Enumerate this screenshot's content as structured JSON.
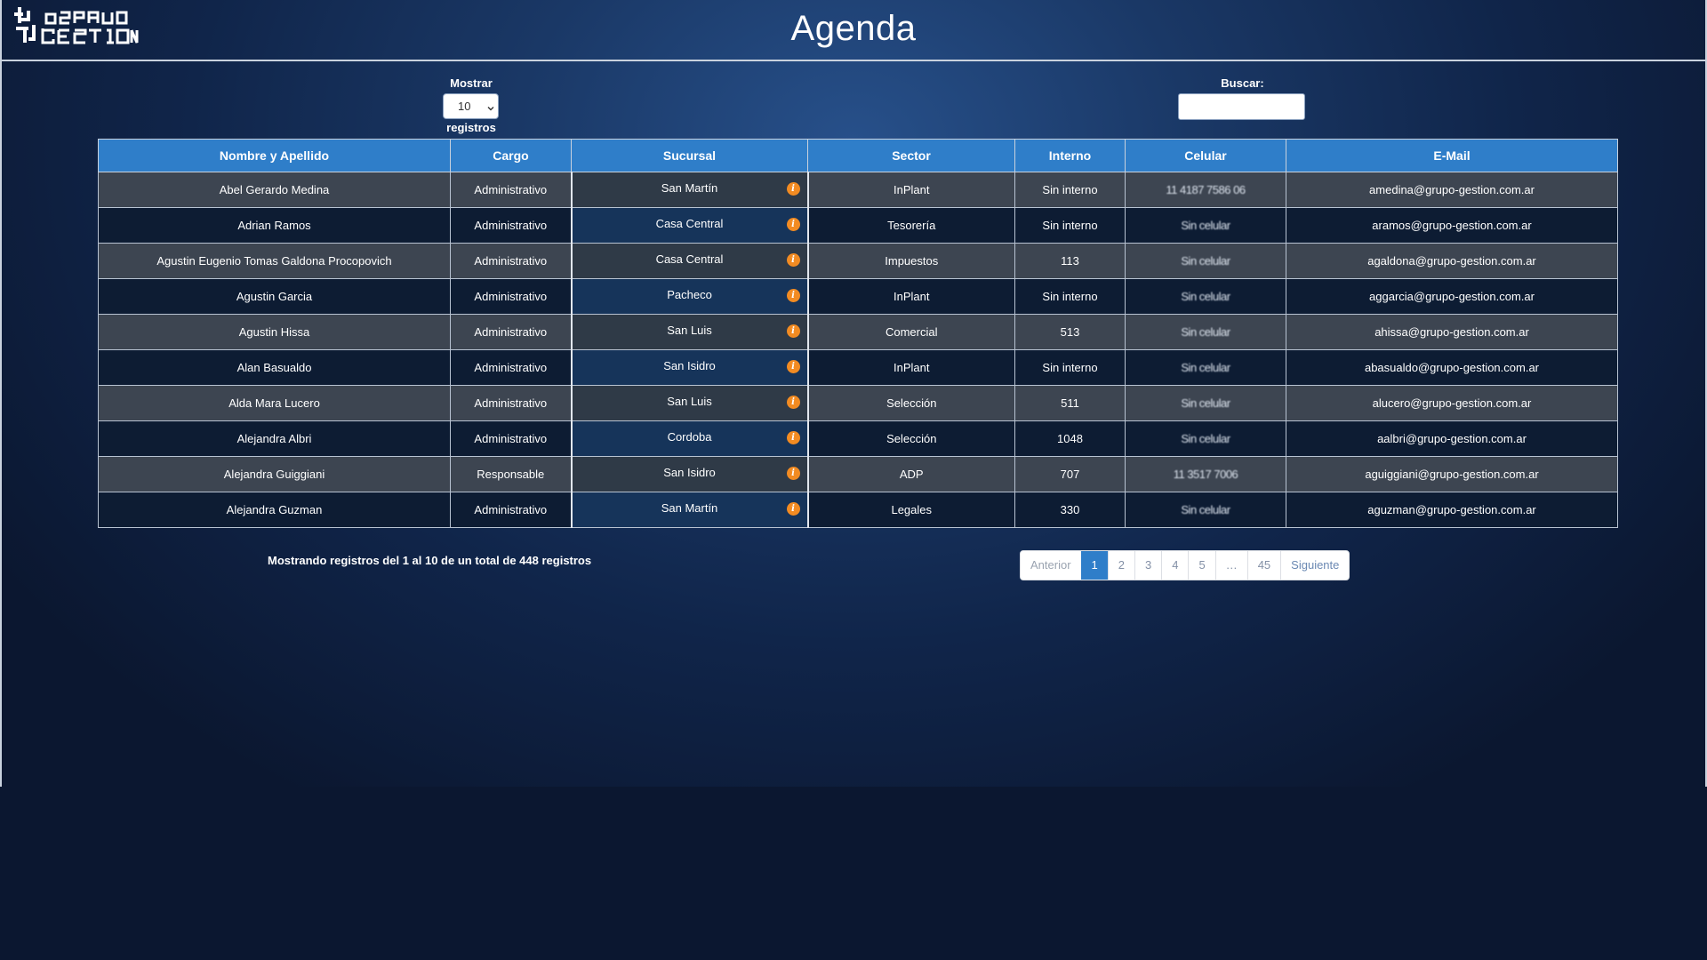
{
  "header": {
    "title": "Agenda",
    "logo_text": "GRUPO GESTION"
  },
  "controls": {
    "show_label": "Mostrar",
    "page_size": "10",
    "records_label": "registros",
    "search_label": "Buscar:",
    "search_value": ""
  },
  "table": {
    "columns": [
      "Nombre y Apellido",
      "Cargo",
      "Sucursal",
      "Sector",
      "Interno",
      "Celular",
      "E-Mail"
    ],
    "rows": [
      {
        "name": "Abel Gerardo Medina",
        "role": "Administrativo",
        "branch": "San Martín",
        "sector": "InPlant",
        "ext": "Sin interno",
        "cell": "11 4187 7586 06",
        "email": "amedina@grupo-gestion.com.ar"
      },
      {
        "name": "Adrian Ramos",
        "role": "Administrativo",
        "branch": "Casa Central",
        "sector": "Tesorería",
        "ext": "Sin interno",
        "cell": "Sin celular",
        "email": "aramos@grupo-gestion.com.ar"
      },
      {
        "name": "Agustin Eugenio Tomas Galdona Procopovich",
        "role": "Administrativo",
        "branch": "Casa Central",
        "sector": "Impuestos",
        "ext": "113",
        "cell": "Sin celular",
        "email": "agaldona@grupo-gestion.com.ar"
      },
      {
        "name": "Agustin Garcia",
        "role": "Administrativo",
        "branch": "Pacheco",
        "sector": "InPlant",
        "ext": "Sin interno",
        "cell": "Sin celular",
        "email": "aggarcia@grupo-gestion.com.ar"
      },
      {
        "name": "Agustin Hissa",
        "role": "Administrativo",
        "branch": "San Luis",
        "sector": "Comercial",
        "ext": "513",
        "cell": "Sin celular",
        "email": "ahissa@grupo-gestion.com.ar"
      },
      {
        "name": "Alan Basualdo",
        "role": "Administrativo",
        "branch": "San Isidro",
        "sector": "InPlant",
        "ext": "Sin interno",
        "cell": "Sin celular",
        "email": "abasualdo@grupo-gestion.com.ar"
      },
      {
        "name": "Alda Mara Lucero",
        "role": "Administrativo",
        "branch": "San Luis",
        "sector": "Selección",
        "ext": "511",
        "cell": "Sin celular",
        "email": "alucero@grupo-gestion.com.ar"
      },
      {
        "name": "Alejandra Albri",
        "role": "Administrativo",
        "branch": "Cordoba",
        "sector": "Selección",
        "ext": "1048",
        "cell": "Sin celular",
        "email": "aalbri@grupo-gestion.com.ar"
      },
      {
        "name": "Alejandra Guiggiani",
        "role": "Responsable",
        "branch": "San Isidro",
        "sector": "ADP",
        "ext": "707",
        "cell": "11 3517 7006",
        "email": "aguiggiani@grupo-gestion.com.ar"
      },
      {
        "name": "Alejandra Guzman",
        "role": "Administrativo",
        "branch": "San Martín",
        "sector": "Legales",
        "ext": "330",
        "cell": "Sin celular",
        "email": "aguzman@grupo-gestion.com.ar"
      }
    ]
  },
  "footer": {
    "info": "Mostrando registros del 1 al 10 de un total de 448 registros"
  },
  "pagination": {
    "prev": "Anterior",
    "pages": [
      "1",
      "2",
      "3",
      "4",
      "5",
      "…",
      "45"
    ],
    "active": "1",
    "next": "Siguiente"
  },
  "colors": {
    "header_row": "#2f7ec9",
    "info_icon": "#f28b22",
    "page_bg": "#0b1730"
  },
  "icons": {
    "branch_info": "info-icon",
    "dropdown": "chevron-down-icon"
  }
}
